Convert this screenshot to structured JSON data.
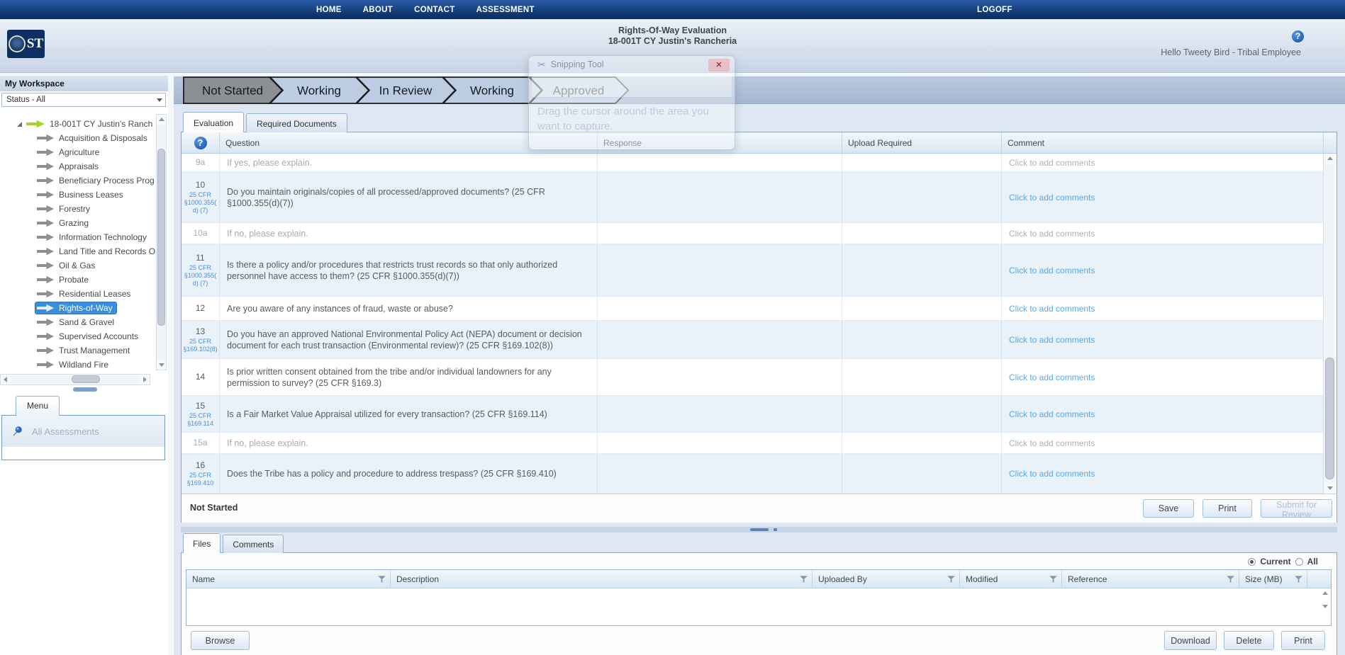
{
  "nav": {
    "items": [
      "HOME",
      "ABOUT",
      "CONTACT",
      "ASSESSMENT"
    ],
    "logoff": "LOGOFF"
  },
  "header": {
    "logo_text": "ST",
    "title_line1": "Rights-Of-Way Evaluation",
    "title_line2": "18-001T CY Justin's Rancheria",
    "help_icon": "?",
    "greeting": "Hello Tweety Bird - Tribal Employee"
  },
  "workflow": {
    "steps": [
      {
        "label": "Not Started",
        "current": true
      },
      {
        "label": "Working",
        "current": false
      },
      {
        "label": "In Review",
        "current": false
      },
      {
        "label": "Working",
        "current": false
      },
      {
        "label": "Approved",
        "current": false
      }
    ]
  },
  "sidebar": {
    "title": "My Workspace",
    "status_filter": "Status - All",
    "tree_root": "18-001T CY Justin's Ranch",
    "tree_items": [
      "Acquisition & Disposals",
      "Agriculture",
      "Appraisals",
      "Beneficiary Process Prog",
      "Business Leases",
      "Forestry",
      "Grazing",
      "Information Technology",
      "Land Title and Records O",
      "Oil & Gas",
      "Probate",
      "Residential Leases",
      "Rights-of-Way",
      "Sand & Gravel",
      "Supervised Accounts",
      "Trust Management",
      "Wildland Fire"
    ],
    "selected_item": "Rights-of-Way",
    "menu_tab": "Menu",
    "menu_item": "All Assessments"
  },
  "evaluation": {
    "tabs": [
      "Evaluation",
      "Required Documents"
    ],
    "active_tab": "Evaluation",
    "columns": [
      "Question",
      "Response",
      "Upload Required",
      "Comment"
    ],
    "rows": [
      {
        "num": "9a",
        "cfr": "",
        "question": "If yes, please explain.",
        "comment": "Click to add comments"
      },
      {
        "num": "10",
        "cfr": "25 CFR §1000.355(d) (7)",
        "question": "Do you maintain originals/copies of all processed/approved documents? (25 CFR §1000.355(d)(7))",
        "comment": "Click to add comments"
      },
      {
        "num": "10a",
        "cfr": "",
        "question": "If no, please explain.",
        "comment": "Click to add comments"
      },
      {
        "num": "11",
        "cfr": "25 CFR §1000.355(d) (7)",
        "question": "Is there a policy and/or procedures that restricts trust records so that only authorized personnel have access to them? (25 CFR §1000.355(d)(7))",
        "comment": "Click to add comments"
      },
      {
        "num": "12",
        "cfr": "",
        "question": "Are you aware of any instances of fraud, waste or abuse?",
        "comment": "Click to add comments"
      },
      {
        "num": "13",
        "cfr": "25 CFR §169.102(8)",
        "question": "Do you have an approved National Environmental Policy Act (NEPA) document or decision document for each trust transaction (Environmental review)? (25 CFR §169.102(8))",
        "comment": "Click to add comments"
      },
      {
        "num": "14",
        "cfr": "",
        "question": "Is prior written consent obtained from the tribe and/or individual landowners for any permission to survey? (25 CFR §169.3)",
        "comment": "Click to add comments"
      },
      {
        "num": "15",
        "cfr": "25 CFR §169.114",
        "question": "Is a Fair Market Value Appraisal utilized for every transaction? (25 CFR §169.114)",
        "comment": "Click to add comments"
      },
      {
        "num": "15a",
        "cfr": "",
        "question": "If no, please explain.",
        "comment": "Click to add comments"
      },
      {
        "num": "16",
        "cfr": "25 CFR §169.410",
        "question": "Does the Tribe has a policy and procedure to address trespass? (25 CFR §169.410)",
        "comment": "Click to add comments"
      }
    ],
    "status": "Not Started",
    "save_label": "Save",
    "print_label": "Print",
    "submit_label": "Submit for Review"
  },
  "files_panel": {
    "tabs": [
      "Files",
      "Comments"
    ],
    "active_tab": "Files",
    "filter_current": "Current",
    "filter_all": "All",
    "columns": [
      "Name",
      "Description",
      "Uploaded By",
      "Modified",
      "Reference",
      "Size (MB)"
    ],
    "browse_label": "Browse",
    "download_label": "Download",
    "delete_label": "Delete",
    "print_label": "Print"
  },
  "snipping_tool": {
    "title": "Snipping Tool",
    "scissors_icon": "✂",
    "message": "Drag the cursor around the area you want to capture.",
    "close_label": "✕"
  },
  "colors": {
    "navbar_blue": "#16407f",
    "accent_blue": "#2f72c8",
    "selected_item_bg": "#3a8ede",
    "chevron_current": "#8b9094",
    "chevron_pending": "#bccde3",
    "link_blue": "#4a90d9",
    "comment_link_blue": "#5aa7e3"
  }
}
